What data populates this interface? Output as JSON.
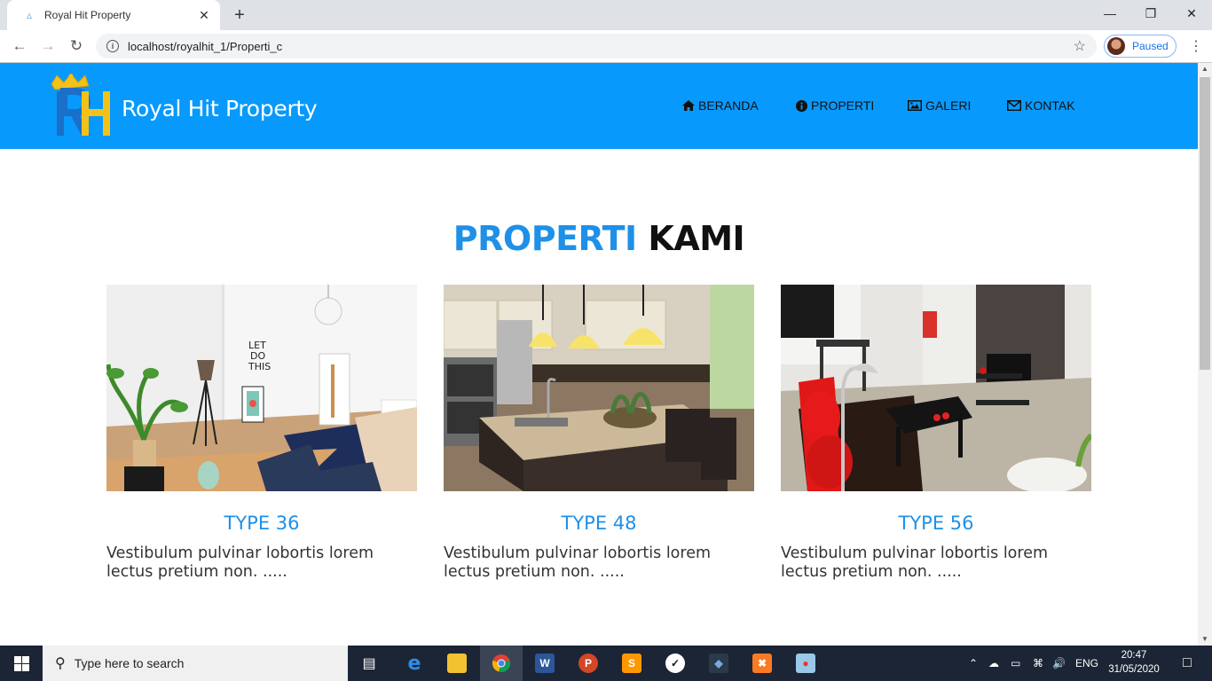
{
  "browser": {
    "tab_title": "Royal Hit Property",
    "url": "localhost/royalhit_1/Properti_c",
    "profile_label": "Paused"
  },
  "site": {
    "brand": "Royal Hit Property",
    "colors": {
      "header": "#0899fc",
      "accent": "#1e90e8"
    },
    "nav": [
      {
        "icon": "home-icon",
        "label": "BERANDA"
      },
      {
        "icon": "info-circle-icon",
        "label": "PROPERTI"
      },
      {
        "icon": "image-icon",
        "label": "GALERI"
      },
      {
        "icon": "envelope-icon",
        "label": "KONTAK"
      }
    ],
    "heading": {
      "part1": "PROPERTI",
      "part2": "KAMI"
    },
    "properties": [
      {
        "type": "TYPE 36",
        "description": "Vestibulum pulvinar lobortis lorem lectus pretium non. ....."
      },
      {
        "type": "TYPE 48",
        "description": "Vestibulum pulvinar lobortis lorem lectus pretium non. ....."
      },
      {
        "type": "TYPE 56",
        "description": "Vestibulum pulvinar lobortis lorem lectus pretium non. ....."
      }
    ]
  },
  "taskbar": {
    "search_placeholder": "Type here to search",
    "language": "ENG",
    "time": "20:47",
    "date": "31/05/2020"
  }
}
